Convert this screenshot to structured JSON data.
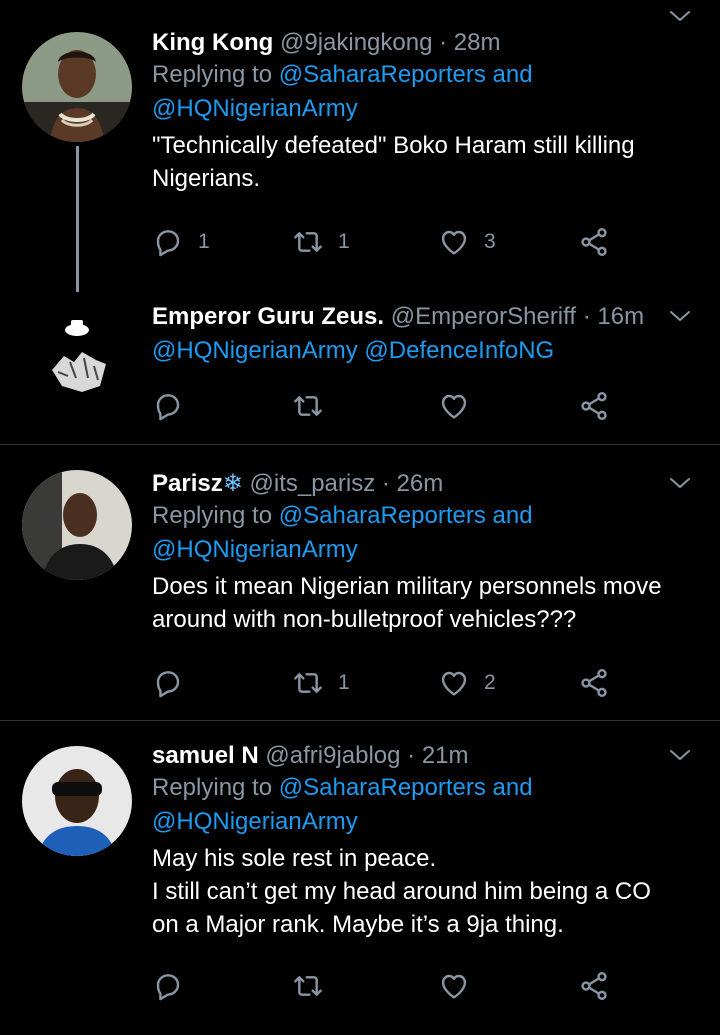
{
  "tweets": [
    {
      "name": "King Kong",
      "handle": "@9jakingkong",
      "time": "· 28m",
      "replying_prefix": "Replying to ",
      "replying_to_1": "@SaharaReporters and",
      "replying_to_2": "@HQNigerianArmy",
      "text_lines": [
        "\"Technically defeated\" Boko Haram still killing",
        "Nigerians."
      ],
      "reply_count": "1",
      "retweet_count": "1",
      "like_count": "3"
    },
    {
      "name": "Emperor Guru Zeus.",
      "handle": "@EmperorSheriff",
      "time": "· 16m",
      "mentions": "@HQNigerianArmy @DefenceInfoNG",
      "reply_count": "",
      "retweet_count": "",
      "like_count": ""
    },
    {
      "name": "Parisz",
      "name_emoji": "❄",
      "handle": "@its_parisz",
      "time": "· 26m",
      "replying_prefix": "Replying to ",
      "replying_to_1": "@SaharaReporters and",
      "replying_to_2": "@HQNigerianArmy",
      "text_lines": [
        "Does it mean Nigerian military personnels move",
        "around with non-bulletproof vehicles???"
      ],
      "reply_count": "",
      "retweet_count": "1",
      "like_count": "2"
    },
    {
      "name": "samuel N",
      "handle": "@afri9jablog",
      "time": "· 21m",
      "replying_prefix": "Replying to ",
      "replying_to_1": "@SaharaReporters and",
      "replying_to_2": "@HQNigerianArmy",
      "text_lines": [
        "May his sole rest in peace.",
        "I still can’t get my head around him being a CO",
        "on a Major rank. Maybe it’s a 9ja thing."
      ],
      "reply_count": "",
      "retweet_count": "",
      "like_count": ""
    }
  ],
  "colors": {
    "background": "#000000",
    "text": "#ffffff",
    "muted": "#8a96a3",
    "link": "#1d9bf0",
    "divider": "#2f3336"
  },
  "icons": [
    "reply-icon",
    "retweet-icon",
    "like-icon",
    "share-icon",
    "chevron-down-icon"
  ]
}
